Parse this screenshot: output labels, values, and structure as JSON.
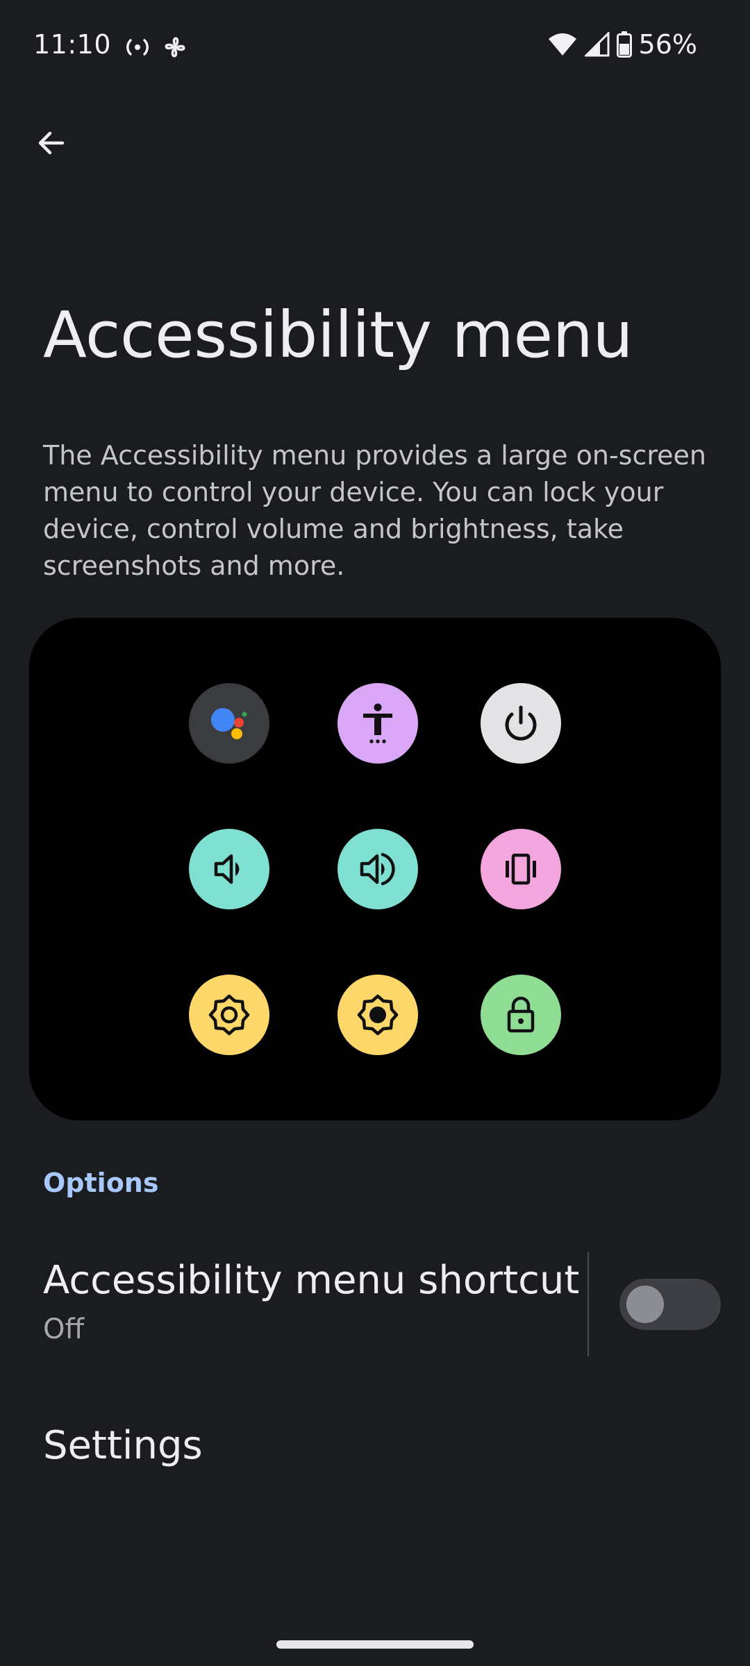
{
  "status_bar": {
    "time": "11:10",
    "battery": "56%",
    "icons": [
      "hotspot-icon",
      "fan-icon",
      "wifi-icon",
      "cell-signal-icon",
      "battery-icon"
    ]
  },
  "header": {
    "back_icon": "arrow-back-icon",
    "title": "Accessibility menu"
  },
  "description": "The Accessibility menu provides a large on-screen menu to control your device. You can lock your device, control volume and brightness, take screenshots and more.",
  "preview": {
    "tiles": [
      {
        "icon": "google-assistant-icon",
        "color": "#3b3c40"
      },
      {
        "icon": "accessibility-settings-icon",
        "color": "#d9a7f5"
      },
      {
        "icon": "power-icon",
        "color": "#e3e3e6"
      },
      {
        "icon": "volume-down-icon",
        "color": "#7fdfd0"
      },
      {
        "icon": "volume-up-icon",
        "color": "#7fdfd0"
      },
      {
        "icon": "vibrate-icon",
        "color": "#f2a6dd"
      },
      {
        "icon": "brightness-down-icon",
        "color": "#fdd76a"
      },
      {
        "icon": "brightness-up-icon",
        "color": "#fdd76a"
      },
      {
        "icon": "lock-icon",
        "color": "#8fdc95"
      }
    ]
  },
  "options": {
    "header": "Options",
    "shortcut": {
      "title": "Accessibility menu shortcut",
      "status": "Off",
      "enabled": false
    },
    "settings_label": "Settings"
  },
  "colors": {
    "background": "#1b1c1f",
    "accent": "#a8c7fa"
  }
}
